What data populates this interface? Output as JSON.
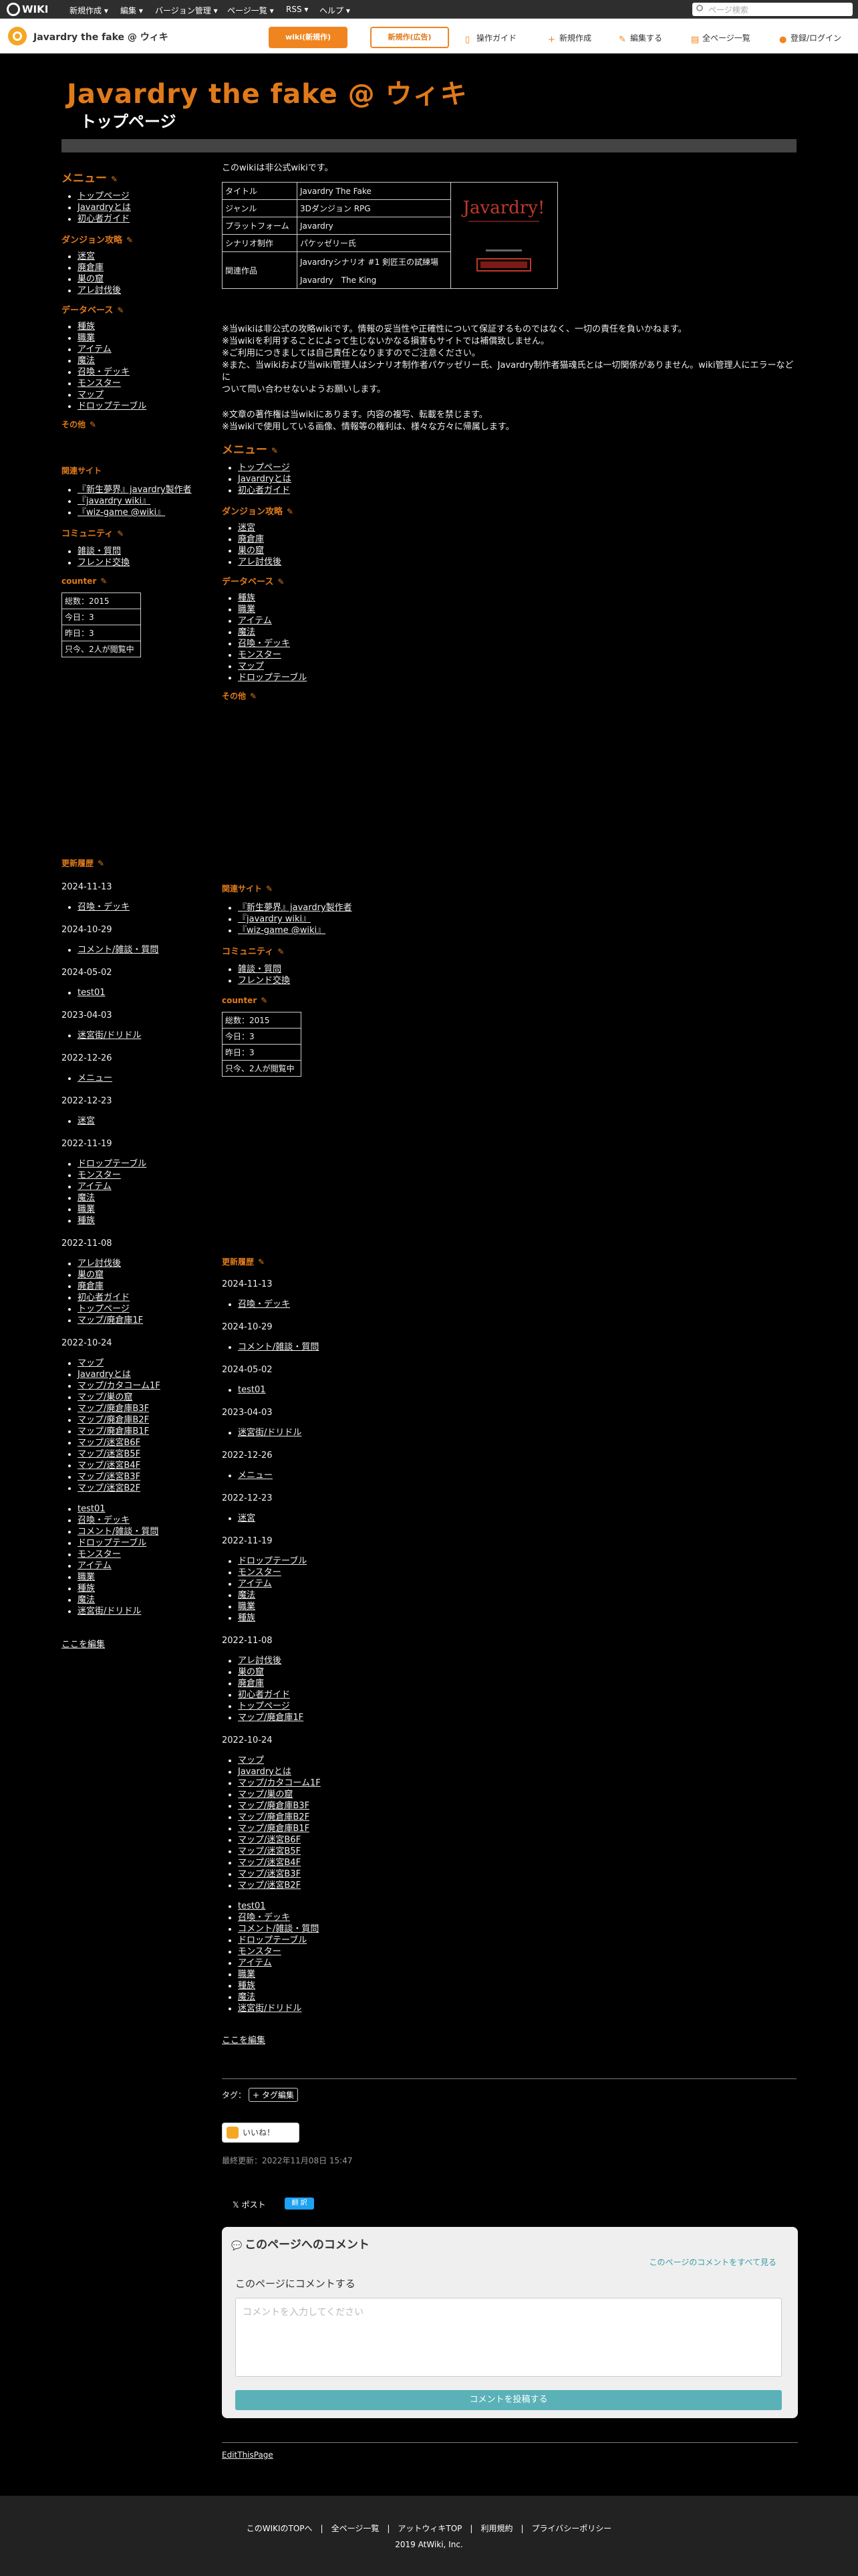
{
  "topbar": {
    "logo": "WIKI",
    "menus": [
      "新規作成 ▾",
      "編集 ▾",
      "バージョン管理 ▾",
      "ページ一覧 ▾",
      "RSS ▾",
      "ヘルプ ▾"
    ],
    "search_placeholder": "ページ検索"
  },
  "wikibar": {
    "title": "Javardry the fake @ ウィキ",
    "btn_orange": "wiki(新規作)",
    "btn_white": "新規作(広告)",
    "items": [
      "操作ガイド",
      "新規作成",
      "編集する",
      "全ページ一覧",
      "登録/ログイン"
    ]
  },
  "page": {
    "site_title": "Javardry the fake @ ウィキ",
    "page_title": "トップページ"
  },
  "menu": {
    "heading": "メニュー",
    "items": [
      "トップページ",
      "Javardryとは",
      "初心者ガイド"
    ],
    "dungeon_heading": "ダンジョン攻略",
    "dungeon_items": [
      "迷宮",
      "廃倉庫",
      "巣の窟",
      "アレ討伐後"
    ],
    "db_heading": "データベース",
    "db_items": [
      "種族",
      "職業",
      "アイテム",
      "魔法",
      "召喚・デッキ",
      "モンスター",
      "マップ",
      "ドロップテーブル"
    ],
    "other": "その他",
    "related_heading": "関連サイト",
    "related_items": [
      "『新生夢界』javardry製作者",
      "『javardry wiki』",
      "『wiz-game @wiki』"
    ],
    "community_heading": "コミュニティ",
    "community_items": [
      "雑談・質問",
      "フレンド交換"
    ],
    "counter_heading": "counter",
    "counter": [
      "総数：2015",
      "今日：3",
      "昨日：3",
      "只今、2人が閲覧中"
    ]
  },
  "updates": {
    "heading": "更新履歴",
    "groups": [
      {
        "date": "2024-11-13",
        "items": [
          "召喚・デッキ"
        ]
      },
      {
        "date": "2024-10-29",
        "items": [
          "コメント/雑談・質問"
        ]
      },
      {
        "date": "2024-05-02",
        "items": [
          "test01"
        ]
      },
      {
        "date": "2023-04-03",
        "items": [
          "迷宮街/ドリドル"
        ]
      },
      {
        "date": "2022-12-26",
        "items": [
          "メニュー"
        ]
      },
      {
        "date": "2022-12-23",
        "items": [
          "迷宮"
        ]
      },
      {
        "date": "2022-11-19",
        "items": [
          "ドロップテーブル",
          "モンスター",
          "アイテム",
          "魔法",
          "職業",
          "種族"
        ]
      },
      {
        "date": "2022-11-08",
        "items": [
          "アレ討伐後",
          "巣の窟",
          "廃倉庫",
          "初心者ガイド",
          "トップページ",
          "マップ/廃倉庫1F"
        ]
      },
      {
        "date": "2022-10-24",
        "items": [
          "マップ",
          "Javardryとは",
          "マップ/カタコーム1F",
          "マップ/巣の窟",
          "マップ/廃倉庫B3F",
          "マップ/廃倉庫B2F",
          "マップ/廃倉庫B1F",
          "マップ/迷宮B6F",
          "マップ/迷宮B5F",
          "マップ/迷宮B4F",
          "マップ/迷宮B3F",
          "マップ/迷宮B2F"
        ]
      }
    ],
    "extra_items": [
      "test01",
      "召喚・デッキ",
      "コメント/雑談・質問",
      "ドロップテーブル",
      "モンスター",
      "アイテム",
      "職業",
      "種族",
      "魔法",
      "迷宮街/ドリドル"
    ],
    "edit_here": "ここを編集"
  },
  "main": {
    "intro": "このwikiは非公式wikiです。",
    "info_rows": [
      {
        "k": "タイトル",
        "v": "Javardry The Fake"
      },
      {
        "k": "ジャンル",
        "v": "3Dダンジョン RPG"
      },
      {
        "k": "プラットフォーム",
        "v": "Javardry"
      },
      {
        "k": "シナリオ制作",
        "v": "パケッゼリー氏"
      },
      {
        "k": "関連作品",
        "v": "Javardryシナリオ #1 剣匠王の試練場"
      },
      {
        "k": "",
        "v": "Javardry　The King"
      }
    ],
    "logo_text": "Javardry!",
    "notes1": [
      "※当wikiは非公式の攻略wikiです。情報の妥当性や正確性について保証するものではなく、一切の責任を負いかねます。",
      "※当wikiを利用することによって生じないかなる損害もサイトでは補償致しません。",
      "※ご利用につきましては自己責任となりますのでご注意ください。",
      "※また、当wikiおよび当wiki管理人はシナリオ制作者パケッゼリー氏、Javardry制作者猫魂氏とは一切関係がありません。wiki管理人にエラーなどに",
      "ついて問い合わせないようお願いします。"
    ],
    "notes2": [
      "※文章の著作権は当wikiにあります。内容の複写、転載を禁じます。",
      "※当wikiで使用している画像、情報等の権利は、様々な方々に帰属します。"
    ]
  },
  "bottom": {
    "tags_label": "タグ：",
    "tag_button": "+ タグ編集",
    "like": "いいね！",
    "last_modified": "最終更新：2022年11月08日 15:47",
    "post": "𝕏 ポスト",
    "share_count": "翻 訳",
    "comment_title": "このページへのコメント",
    "comment_all": "このページのコメントをすべて見る",
    "comment_label": "このページにコメントする",
    "comment_placeholder": "コメントを入力してください",
    "comment_submit": "コメントを投稿する",
    "edit_this": "EditThisPage"
  },
  "footer": {
    "links": "このWIKIのTOPへ　|　全ページ一覧　|　アットウィキTOP　|　利用規約　|　プライバシーポリシー",
    "copy": "2019 AtWiki, Inc."
  }
}
